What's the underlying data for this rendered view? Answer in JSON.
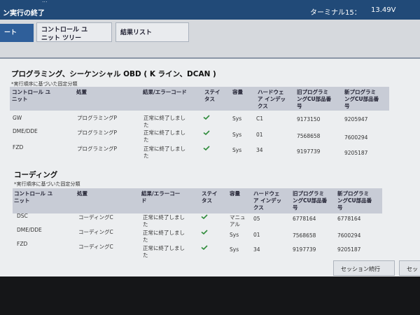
{
  "topbar": {
    "cut_text": "...",
    "title": "ン実行の終了",
    "terminal": "ターミナル15：",
    "voltage": "13.49V",
    "accent_color": "#214a78"
  },
  "tabs": [
    {
      "label": "ート"
    },
    {
      "label": "コントロール ユ\nニット ツリー"
    },
    {
      "label": "結果リスト"
    }
  ],
  "sections": [
    {
      "title": "プログラミング、シーケンシャル OBD ( K ライン、DCAN )",
      "note": "*実行順序に基づいた固定分類",
      "headers": [
        "コントロール ユ\nニット",
        "処置",
        "結果/エラーコード",
        "ステイ\nタス",
        "容量",
        "ハードウェ\nア インデッ\nクス",
        "旧プログラミ\nングCU部品番\n号",
        "新プログラミ\nングCU部品番\n号"
      ],
      "rows": [
        {
          "unit": "GW",
          "action": "プログラミングP",
          "result": "正常に終了しまし\nた",
          "status": "ok",
          "capacity": "Sys",
          "hw": "C1",
          "old_pn": "9173150",
          "new_pn": "9205947"
        },
        {
          "unit": "DME/DDE",
          "action": "プログラミングP",
          "result": "正常に終了しまし\nた",
          "status": "ok",
          "capacity": "Sys",
          "hw": "01",
          "old_pn": "7568658",
          "new_pn": "7600294"
        },
        {
          "unit": "FZD",
          "action": "プログラミングP",
          "result": "正常に終了しまし\nた",
          "status": "ok",
          "capacity": "Sys",
          "hw": "34",
          "old_pn": "9197739",
          "new_pn": "9205187"
        }
      ]
    },
    {
      "title": "コーディング",
      "note": "*実行順序に基づいた固定分類",
      "headers": [
        "コントロール ユ\nニット",
        "処置",
        "結果/エラーコー\nド",
        "ステイ\nタス",
        "容量",
        "ハードウェ\nア インデッ\nクス",
        "旧プログラミ\nングCU部品番\n号",
        "新プログラミ\nングCU部品番\n号"
      ],
      "rows": [
        {
          "unit": "DSC",
          "action": "コーディングC",
          "result": "正常に終了しまし\nた",
          "status": "ok",
          "capacity": "マニュ\nアル",
          "hw": "05",
          "old_pn": "6778164",
          "new_pn": "6778164"
        },
        {
          "unit": "DME/DDE",
          "action": "コーディングC",
          "result": "正常に終了しまし\nた",
          "status": "ok",
          "capacity": "Sys",
          "hw": "01",
          "old_pn": "7568658",
          "new_pn": "7600294"
        },
        {
          "unit": "FZD",
          "action": "コーディングC",
          "result": "正常に終了しまし\nた",
          "status": "ok",
          "capacity": "Sys",
          "hw": "34",
          "old_pn": "9197739",
          "new_pn": "9205187"
        }
      ]
    }
  ],
  "buttons": {
    "continue_session": "セッション続行",
    "cut_button": "セッ"
  },
  "status_ok_color": "#2e8b3a"
}
